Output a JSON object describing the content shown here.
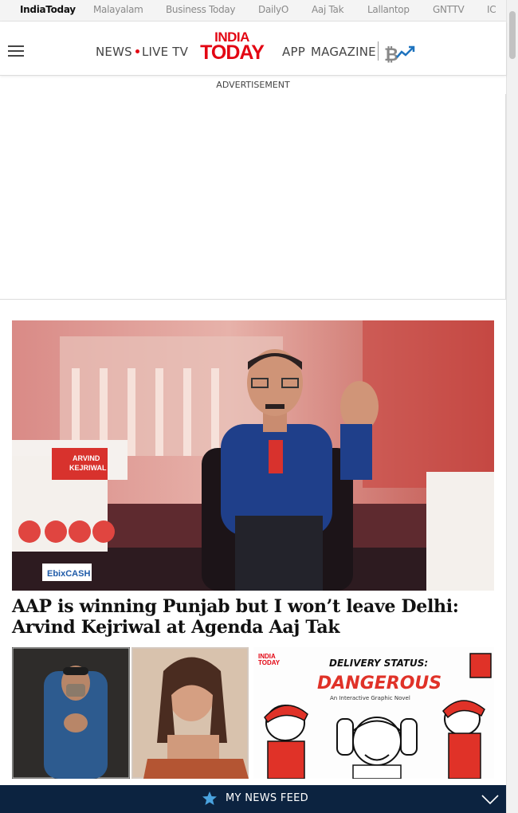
{
  "top_nav": {
    "items": [
      "IndiaToday",
      "Malayalam",
      "Business Today",
      "DailyO",
      "Aaj Tak",
      "Lallantop",
      "GNTTV",
      "IC"
    ],
    "active_index": 0
  },
  "header": {
    "nav_left": [
      "NEWS",
      "LIVE TV"
    ],
    "logo_line1": "INDIA",
    "logo_line2": "TODAY",
    "nav_right": [
      "APP",
      "MAGAZINE"
    ]
  },
  "ad": {
    "label": "ADVERTISEMENT"
  },
  "hero_image": {
    "banner_name_line1": "ARVIND",
    "banner_name_line2": "KEJRIWAL",
    "sponsor": "EbixCASH"
  },
  "hero_story": {
    "headline": "AAP is winning Punjab but I won’t leave Delhi: Arvind Kejriwal at Agenda Aaj Tak"
  },
  "thumbnails": [
    {},
    {
      "logo_line1": "INDIA",
      "logo_line2": "TODAY",
      "title_line1": "DELIVERY STATUS:",
      "title_line2": "DANGEROUS",
      "subtitle": "An Interactive Graphic Novel"
    }
  ],
  "feed_bar": {
    "label": "MY NEWS FEED"
  },
  "colors": {
    "brand_red": "#e30613",
    "feed_bar_bg": "#0c2340"
  }
}
